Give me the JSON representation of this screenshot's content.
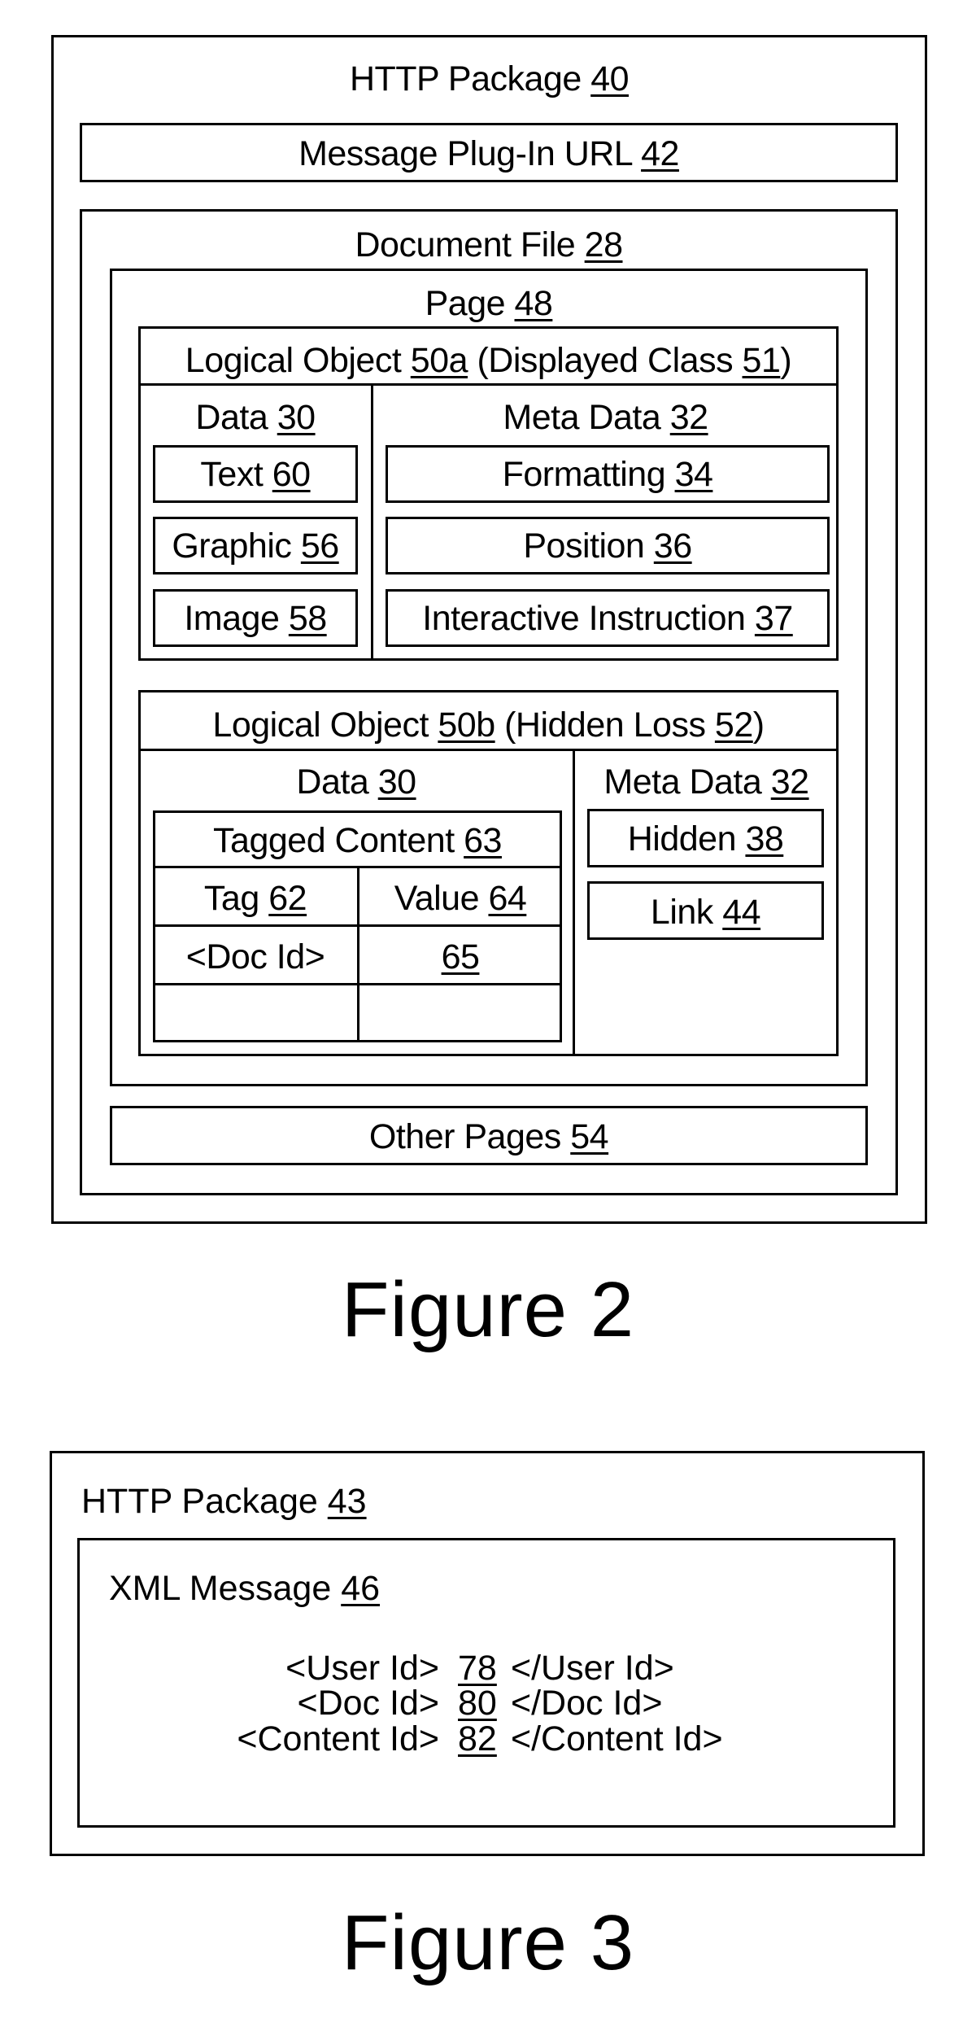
{
  "figure2": {
    "caption": "Figure 2",
    "http_package": {
      "label": "HTTP Package",
      "ref": "40"
    },
    "message_plugin_url": {
      "label": "Message Plug-In URL",
      "ref": "42"
    },
    "document_file": {
      "label": "Document File",
      "ref": "28"
    },
    "page": {
      "label": "Page",
      "ref": "48"
    },
    "logical_object_a": {
      "label_prefix": "Logical Object",
      "ref": "50a",
      "class_label": "Displayed Class",
      "class_ref": "51",
      "data": {
        "label": "Data",
        "ref": "30",
        "items": [
          {
            "label": "Text",
            "ref": "60"
          },
          {
            "label": "Graphic",
            "ref": "56"
          },
          {
            "label": "Image",
            "ref": "58"
          }
        ]
      },
      "meta": {
        "label": "Meta Data",
        "ref": "32",
        "items": [
          {
            "label": "Formatting",
            "ref": "34"
          },
          {
            "label": "Position",
            "ref": "36"
          },
          {
            "label": "Interactive Instruction",
            "ref": "37"
          }
        ]
      }
    },
    "logical_object_b": {
      "label_prefix": "Logical Object",
      "ref": "50b",
      "class_label": "Hidden Loss",
      "class_ref": "52",
      "data": {
        "label": "Data",
        "ref": "30",
        "tagged_content": {
          "label": "Tagged Content",
          "ref": "63",
          "columns": [
            {
              "label": "Tag",
              "ref": "62"
            },
            {
              "label": "Value",
              "ref": "64"
            }
          ],
          "rows": [
            {
              "tag": "<Doc Id>",
              "value_ref": "65"
            },
            {
              "tag": "",
              "value_ref": ""
            }
          ]
        }
      },
      "meta": {
        "label": "Meta Data",
        "ref": "32",
        "items": [
          {
            "label": "Hidden",
            "ref": "38"
          },
          {
            "label": "Link",
            "ref": "44"
          }
        ]
      }
    },
    "other_pages": {
      "label": "Other Pages",
      "ref": "54"
    }
  },
  "figure3": {
    "caption": "Figure 3",
    "http_package": {
      "label": "HTTP Package",
      "ref": "43"
    },
    "xml_message": {
      "label": "XML Message",
      "ref": "46",
      "rows": [
        {
          "open": "<User Id>",
          "ref": "78",
          "close": "</User Id>"
        },
        {
          "open": "<Doc Id>",
          "ref": "80",
          "close": "</Doc Id>"
        },
        {
          "open": "<Content Id>",
          "ref": "82",
          "close": "</Content Id>"
        }
      ]
    }
  }
}
